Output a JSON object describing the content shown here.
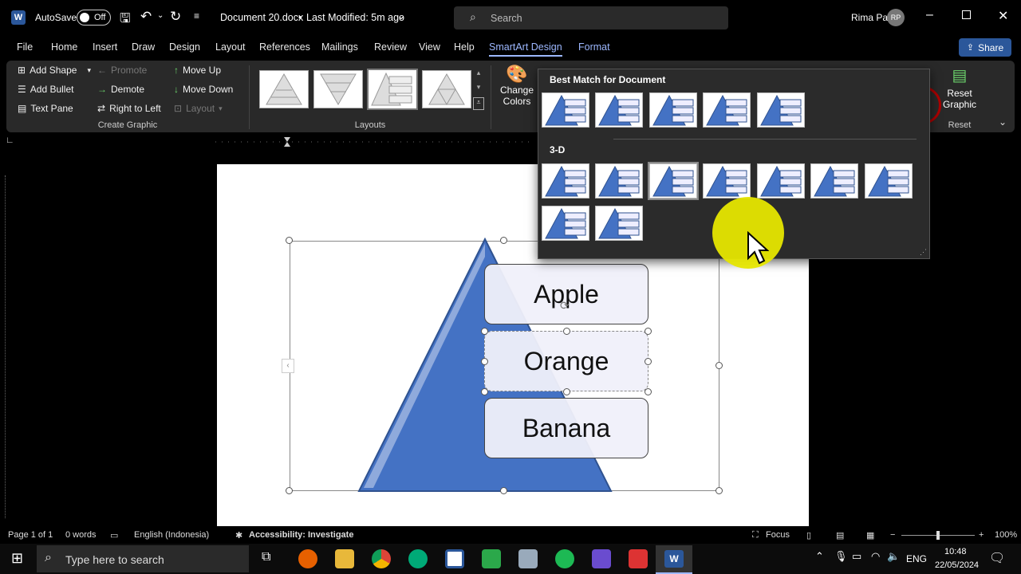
{
  "titlebar": {
    "autosave_label": "AutoSave",
    "autosave_state": "Off",
    "doc_title": "Document 20.docx",
    "separator": "•",
    "last_modified": "Last Modified: 5m ago",
    "search_placeholder": "Search",
    "user_name": "Rima Pa",
    "user_initials": "RP"
  },
  "tabs": [
    "File",
    "Home",
    "Insert",
    "Draw",
    "Design",
    "Layout",
    "References",
    "Mailings",
    "Review",
    "View",
    "Help",
    "SmartArt Design",
    "Format"
  ],
  "share_label": "Share",
  "ribbon": {
    "add_shape": "Add Shape",
    "add_bullet": "Add Bullet",
    "text_pane": "Text Pane",
    "promote": "Promote",
    "demote": "Demote",
    "right_to_left": "Right to Left",
    "move_up": "Move Up",
    "move_down": "Move Down",
    "layout": "Layout",
    "create_graphic": "Create Graphic",
    "layouts": "Layouts",
    "change_colors_1": "Change",
    "change_colors_2": "Colors",
    "reset_graphic_1": "Reset",
    "reset_graphic_2": "Graphic",
    "reset_group": "Reset"
  },
  "gallery": {
    "section1": "Best Match for Document",
    "section2": "3-D"
  },
  "smartart": {
    "items": [
      "Apple",
      "Orange",
      "Banana"
    ]
  },
  "status": {
    "page": "Page 1 of 1",
    "words": "0 words",
    "language": "English (Indonesia)",
    "accessibility": "Accessibility: Investigate",
    "focus": "Focus",
    "zoom": "100%"
  },
  "taskbar": {
    "search_placeholder": "Type here to search",
    "lang": "ENG",
    "time": "10:48",
    "date": "22/05/2024"
  },
  "colors": {
    "accent": "#4472c4",
    "active_tab": "#9db8ff",
    "share_bg": "#2b579a"
  }
}
